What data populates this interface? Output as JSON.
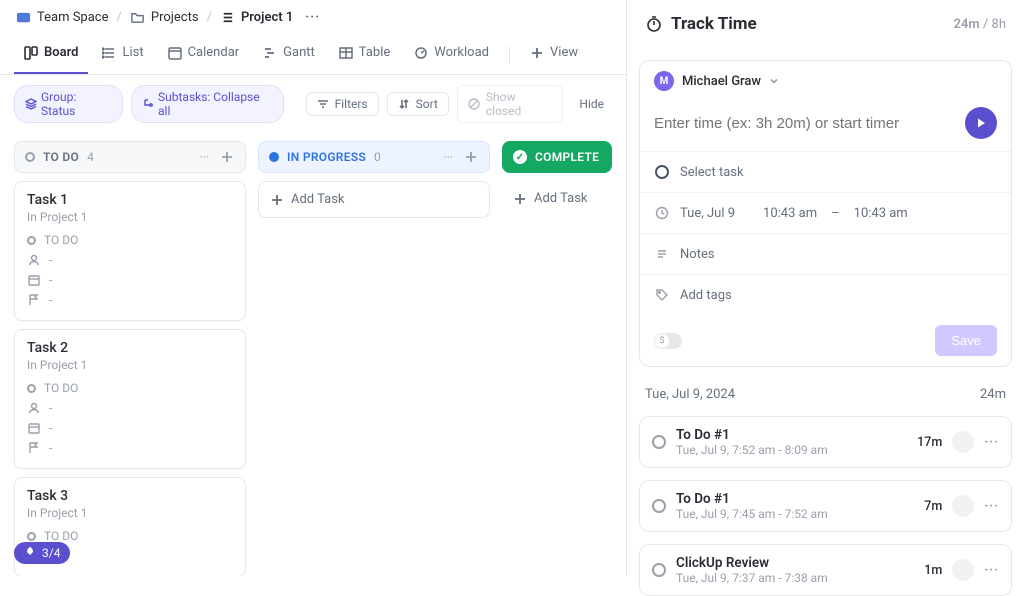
{
  "breadcrumb": {
    "space": "Team Space",
    "folder": "Projects",
    "project": "Project 1"
  },
  "views": [
    "Board",
    "List",
    "Calendar",
    "Gantt",
    "Table",
    "Workload"
  ],
  "addView": "View",
  "filters": {
    "group": "Group: Status",
    "subtasks": "Subtasks: Collapse all",
    "filters_label": "Filters",
    "sort_label": "Sort",
    "show_closed": "Show closed",
    "hide": "Hide"
  },
  "columns": {
    "todo": {
      "name": "TO DO",
      "count": "4"
    },
    "inprog": {
      "name": "IN PROGRESS",
      "count": "0",
      "add": "Add Task"
    },
    "complete": {
      "name": "COMPLETE",
      "add": "Add Task"
    }
  },
  "cards": [
    {
      "title": "Task 1",
      "sub": "In Project 1",
      "status": "TO DO"
    },
    {
      "title": "Task 2",
      "sub": "In Project 1",
      "status": "TO DO"
    },
    {
      "title": "Task 3",
      "sub": "In Project 1",
      "status": "TO DO"
    }
  ],
  "dash": "-",
  "track": {
    "title": "Track Time",
    "elapsed": "24m",
    "cap": "8h",
    "user": {
      "initial": "M",
      "name": "Michael Graw"
    },
    "input_placeholder": "Enter time (ex: 3h 20m) or start timer",
    "select_task": "Select task",
    "date": "Tue, Jul 9",
    "from": "10:43 am",
    "sep": "–",
    "to": "10:43 am",
    "notes": "Notes",
    "tags": "Add tags",
    "save": "Save",
    "log_date": "Tue, Jul 9, 2024",
    "log_total": "24m",
    "logs": [
      {
        "name": "To Do #1",
        "when": "Tue, Jul 9, 7:52 am - 8:09 am",
        "dur": "17m"
      },
      {
        "name": "To Do #1",
        "when": "Tue, Jul 9, 7:45 am - 7:52 am",
        "dur": "7m"
      },
      {
        "name": "ClickUp Review",
        "when": "Tue, Jul 9, 7:37 am - 7:38 am",
        "dur": "1m"
      }
    ]
  },
  "quick": "3/4"
}
